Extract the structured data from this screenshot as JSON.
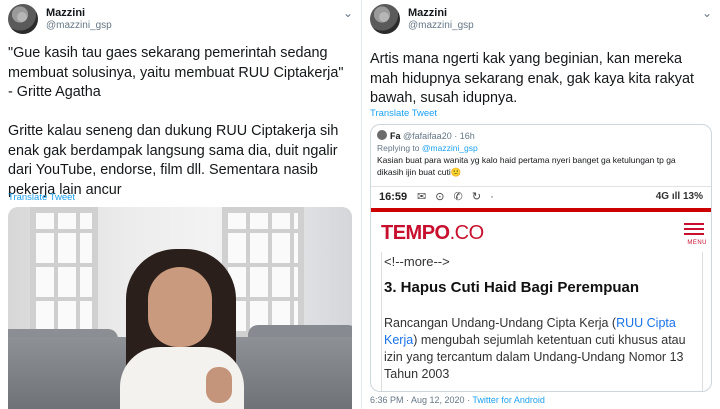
{
  "left_tweet": {
    "user": {
      "name": "Mazzini",
      "handle": "@mazzini_gsp"
    },
    "text": "\"Gue kasih tau gaes sekarang pemerintah sedang membuat solusinya, yaitu membuat RUU Ciptakerja\" - Gritte Agatha\n\nGritte kalau seneng dan dukung RUU Ciptakerja sih enak gak berdampak langsung sama dia, duit ngalir dari YouTube, endorse, film dll. Sementara nasib pekerja lain ancur",
    "translate_label": "Translate Tweet"
  },
  "right_tweet": {
    "user": {
      "name": "Mazzini",
      "handle": "@mazzini_gsp"
    },
    "text": "Artis mana ngerti kak yang beginian, kan mereka mah hidupnya sekarang enak, gak kaya kita rakyat bawah, susah idupnya.",
    "translate_label": "Translate Tweet",
    "quoted": {
      "name": "Fa",
      "handle": "@fafaifaa20 · 16h",
      "replying_prefix": "Replying to ",
      "replying_handle": "@mazzini_gsp",
      "text": "Kasian buat para wanita yg kalo haid pertama nyeri banget ga ketulungan tp ga dikasih ijin buat cuti😕",
      "phone_status": {
        "time": "16:59",
        "icons": "✉ ⊙ ✆ ↻ ·",
        "right": "4G ıll 13%"
      },
      "site": {
        "logo": "TEMPO",
        "logo_suffix": ".CO",
        "menu_label": "MENU"
      },
      "article": {
        "more_tag": "<!--more-->",
        "heading": "3. Hapus Cuti Haid Bagi Perempuan",
        "body_before": "Rancangan Undang-Undang Cipta Kerja (",
        "body_link": "RUU Cipta Kerja",
        "body_after": ") mengubah sejumlah ketentuan cuti khusus atau izin yang tercantum dalam Undang-Undang Nomor 13 Tahun 2003"
      }
    },
    "meta_time": "6:36 PM · Aug 12, 2020 · ",
    "meta_source": "Twitter for Android"
  },
  "icons": {
    "chevron": "chevron-down-icon",
    "menu": "hamburger-menu-icon"
  },
  "colors": {
    "link": "#1da1f2",
    "tempo_red": "#c8102e"
  }
}
